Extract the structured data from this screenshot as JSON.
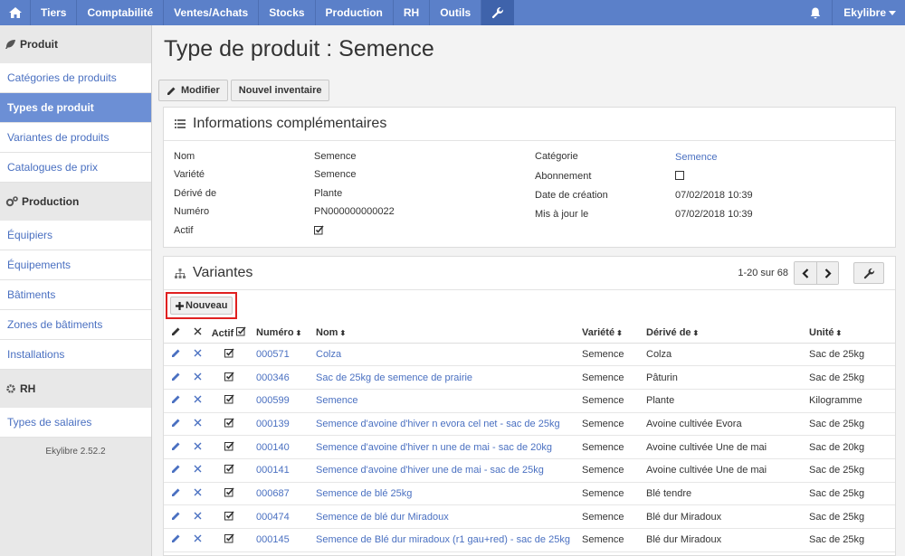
{
  "nav": {
    "items": [
      "Tiers",
      "Comptabilité",
      "Ventes/Achats",
      "Stocks",
      "Production",
      "RH",
      "Outils"
    ],
    "user": "Ekylibre"
  },
  "sidebar": {
    "sections": [
      {
        "title": "Produit",
        "icon": "leaf-icon",
        "items": [
          "Catégories de produits",
          "Types de produit",
          "Variantes de produits",
          "Catalogues de prix"
        ],
        "active": 1
      },
      {
        "title": "Production",
        "icon": "gears-icon",
        "items": [
          "Équipiers",
          "Équipements",
          "Bâtiments",
          "Zones de bâtiments",
          "Installations"
        ],
        "active": -1
      },
      {
        "title": "RH",
        "icon": "gear-icon",
        "items": [
          "Types de salaires"
        ],
        "active": -1
      }
    ],
    "version": "Ekylibre 2.52.2"
  },
  "page": {
    "title": "Type de produit : Semence",
    "buttons": {
      "edit": "Modifier",
      "inventory": "Nouvel inventaire"
    }
  },
  "info": {
    "title": "Informations complémentaires",
    "left": [
      {
        "label": "Nom",
        "value": "Semence"
      },
      {
        "label": "Variété",
        "value": "Semence"
      },
      {
        "label": "Dérivé de",
        "value": "Plante"
      },
      {
        "label": "Numéro",
        "value": "PN000000000022"
      },
      {
        "label": "Actif",
        "value": "checked"
      }
    ],
    "right": [
      {
        "label": "Catégorie",
        "value": "Semence",
        "link": true
      },
      {
        "label": "Abonnement",
        "value": "unchecked"
      },
      {
        "label": "Date de création",
        "value": "07/02/2018 10:39"
      },
      {
        "label": "Mis à jour le",
        "value": "07/02/2018 10:39"
      }
    ]
  },
  "variants": {
    "title": "Variantes",
    "pager": "1-20 sur 68",
    "new_label": "Nouveau",
    "columns": {
      "actif": "Actif",
      "numero": "Numéro",
      "nom": "Nom",
      "variete": "Variété",
      "derive": "Dérivé de",
      "unite": "Unité"
    },
    "rows": [
      {
        "num": "000571",
        "name": "Colza",
        "variety": "Semence",
        "derived": "Colza",
        "unit": "Sac de 25kg"
      },
      {
        "num": "000346",
        "name": "Sac de 25kg de semence de prairie",
        "variety": "Semence",
        "derived": "Pâturin",
        "unit": "Sac de 25kg"
      },
      {
        "num": "000599",
        "name": "Semence",
        "variety": "Semence",
        "derived": "Plante",
        "unit": "Kilogramme"
      },
      {
        "num": "000139",
        "name": "Semence d'avoine d'hiver n evora cel net - sac de 25kg",
        "variety": "Semence",
        "derived": "Avoine cultivée Evora",
        "unit": "Sac de 25kg"
      },
      {
        "num": "000140",
        "name": "Semence d'avoine d'hiver n une de mai - sac de 20kg",
        "variety": "Semence",
        "derived": "Avoine cultivée Une de mai",
        "unit": "Sac de 20kg"
      },
      {
        "num": "000141",
        "name": "Semence d'avoine d'hiver une de mai - sac de 25kg",
        "variety": "Semence",
        "derived": "Avoine cultivée Une de mai",
        "unit": "Sac de 25kg"
      },
      {
        "num": "000687",
        "name": "Semence de blé 25kg",
        "variety": "Semence",
        "derived": "Blé tendre",
        "unit": "Sac de 25kg"
      },
      {
        "num": "000474",
        "name": "Semence de blé dur Miradoux",
        "variety": "Semence",
        "derived": "Blé dur Miradoux",
        "unit": "Sac de 25kg"
      },
      {
        "num": "000145",
        "name": "Semence de Blé dur miradoux (r1 gau+red) - sac de 25kg",
        "variety": "Semence",
        "derived": "Blé dur Miradoux",
        "unit": "Sac de 25kg"
      }
    ]
  },
  "colors": {
    "nav": "#5b80c9",
    "link": "#4a70c1",
    "active_side": "#6c8fd5",
    "highlight": "#e02020"
  }
}
